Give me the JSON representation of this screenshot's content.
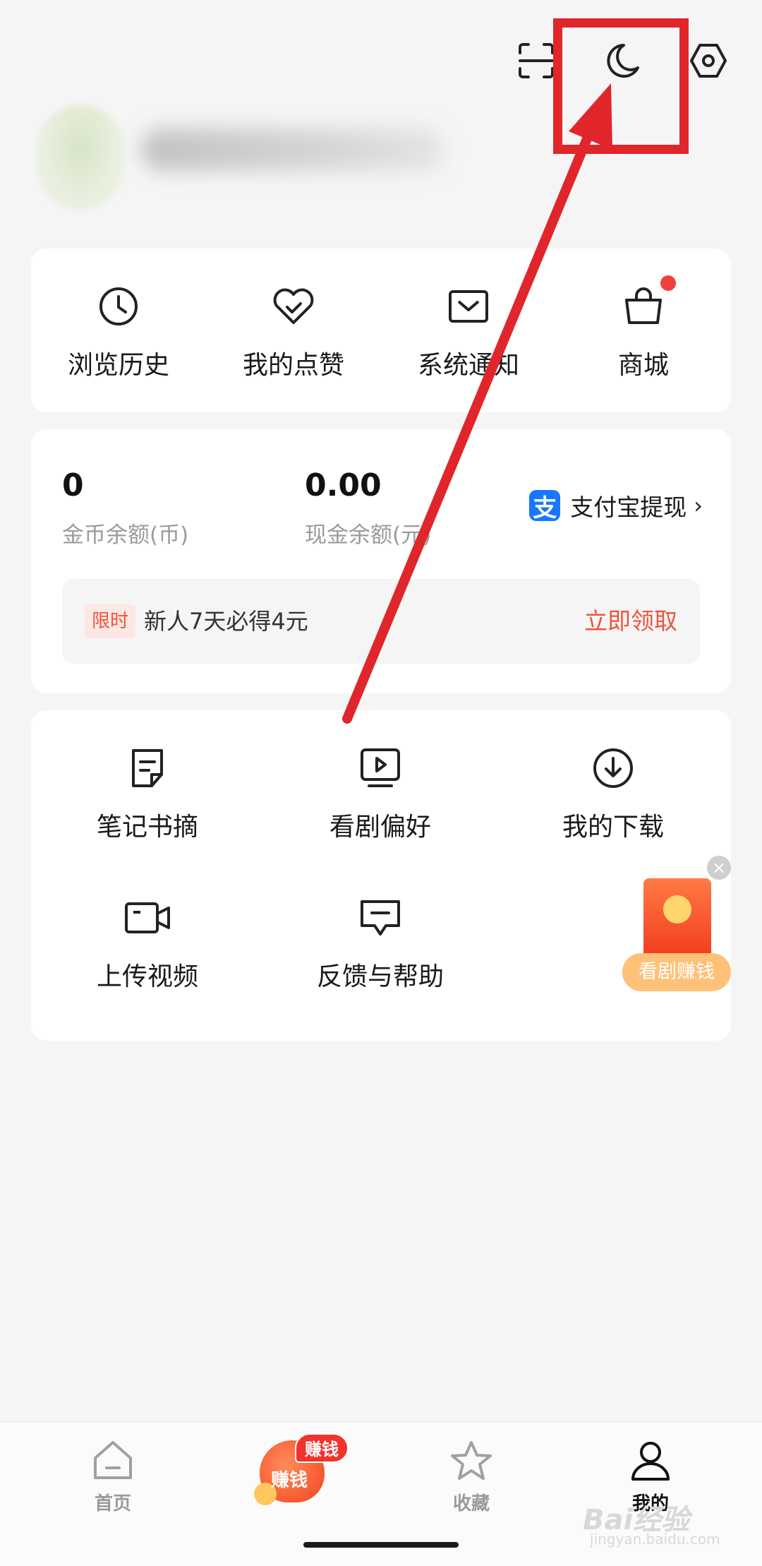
{
  "header": {
    "icons": [
      "scan-icon",
      "moon-icon",
      "settings-icon"
    ]
  },
  "quick_links": [
    {
      "label": "浏览历史",
      "icon": "clock-icon"
    },
    {
      "label": "我的点赞",
      "icon": "heart-icon"
    },
    {
      "label": "系统通知",
      "icon": "mail-icon"
    },
    {
      "label": "商城",
      "icon": "bag-icon",
      "has_dot": true
    }
  ],
  "wallet": {
    "coin_value": "0",
    "coin_label": "金币余额(币)",
    "cash_value": "0.00",
    "cash_label": "现金余额(元)",
    "withdraw_label": "支付宝提现",
    "withdraw_logo": "支",
    "promo_tag": "限时",
    "promo_text": "新人7天必得4元",
    "promo_cta": "立即领取"
  },
  "features": [
    {
      "label": "笔记书摘",
      "icon": "note-icon"
    },
    {
      "label": "看剧偏好",
      "icon": "video-play-icon"
    },
    {
      "label": "我的下载",
      "icon": "download-icon"
    },
    {
      "label": "上传视频",
      "icon": "camera-icon"
    },
    {
      "label": "反馈与帮助",
      "icon": "feedback-icon"
    }
  ],
  "floating_packet": {
    "label": "看剧赚钱",
    "close": "×"
  },
  "bottom_nav": {
    "items": [
      {
        "label": "首页",
        "icon": "home-icon"
      },
      {
        "label": "赚钱",
        "icon": "earn-icon",
        "badge": "赚钱"
      },
      {
        "label": "收藏",
        "icon": "star-icon"
      },
      {
        "label": "我的",
        "icon": "profile-icon",
        "active": true
      }
    ]
  },
  "watermark": {
    "title": "Bai经验",
    "sub": "jingyan.baidu.com"
  },
  "colors": {
    "accent": "#f0533d",
    "annotation": "#e0262b",
    "alipay": "#1677ff",
    "background": "#f5f5f5"
  }
}
